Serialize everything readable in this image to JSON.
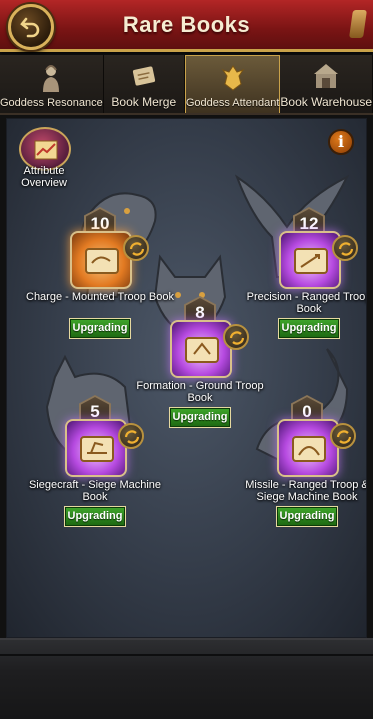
{
  "header": {
    "title": "Rare Books"
  },
  "tabs": [
    {
      "label": "Goddess Resonance",
      "icon": "goddess-icon"
    },
    {
      "label": "Book Merge",
      "icon": "scroll-icon"
    },
    {
      "label": "Goddess Attendant",
      "icon": "griffin-icon",
      "active": true
    },
    {
      "label": "Book Warehouse",
      "icon": "warehouse-icon"
    }
  ],
  "attribute_overview": {
    "label": "Attribute Overview"
  },
  "info": {
    "glyph": "i"
  },
  "books": [
    {
      "level": "10",
      "name": "Charge - Mounted Troop Book",
      "status": "Upgrading",
      "color": "orange"
    },
    {
      "level": "12",
      "name": "Precision - Ranged Troop Book",
      "status": "Upgrading",
      "color": "purple"
    },
    {
      "level": "8",
      "name": "Formation - Ground Troop Book",
      "status": "Upgrading",
      "color": "purple"
    },
    {
      "level": "5",
      "name": "Siegecraft - Siege Machine Book",
      "status": "Upgrading",
      "color": "purple"
    },
    {
      "level": "0",
      "name": "Missile - Ranged Troop & Siege Machine Book",
      "status": "Upgrading",
      "color": "purple"
    }
  ],
  "colors": {
    "header": "#8b1a1a",
    "accent_gold": "#c9a24a",
    "status_green": "#2e8a1e"
  }
}
